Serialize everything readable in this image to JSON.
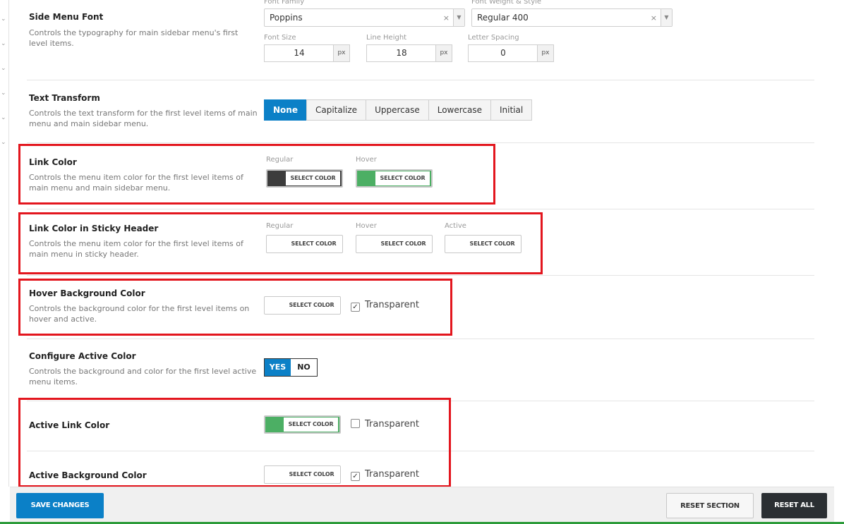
{
  "side_menu_font": {
    "title": "Side Menu Font",
    "desc": "Controls the typography for main sidebar menu's first level items.",
    "font_family_label": "Font Family",
    "font_family_value": "Poppins",
    "font_weight_label": "Font Weight & Style",
    "font_weight_value": "Regular 400",
    "font_size_label": "Font Size",
    "font_size_value": "14",
    "line_height_label": "Line Height",
    "line_height_value": "18",
    "letter_spacing_label": "Letter Spacing",
    "letter_spacing_value": "0",
    "unit": "px",
    "clear_glyph": "×",
    "arrow_glyph": "▼"
  },
  "text_transform": {
    "title": "Text Transform",
    "desc": "Controls the text transform for the first level items of main menu and main sidebar menu.",
    "options": [
      "None",
      "Capitalize",
      "Uppercase",
      "Lowercase",
      "Initial"
    ],
    "selected": "None"
  },
  "link_color": {
    "title": "Link Color",
    "desc": "Controls the menu item color for the first level items of main menu and main sidebar menu.",
    "regular_label": "Regular",
    "hover_label": "Hover",
    "regular_color": "#3c3c3c",
    "hover_color": "#4caf64"
  },
  "sticky_link_color": {
    "title": "Link Color in Sticky Header",
    "desc": "Controls the menu item color for the first level items of main menu in sticky header.",
    "regular_label": "Regular",
    "hover_label": "Hover",
    "active_label": "Active"
  },
  "hover_bg_color": {
    "title": "Hover Background Color",
    "desc": "Controls the background color for the first level items on hover and active.",
    "transparent_label": "Transparent",
    "transparent_checked": true
  },
  "configure_active": {
    "title": "Configure Active Color",
    "desc": "Controls the background and color for the first level active menu items.",
    "yes": "YES",
    "no": "NO",
    "value": "YES"
  },
  "active_link_color": {
    "title": "Active Link Color",
    "color": "#4caf64",
    "transparent_label": "Transparent",
    "transparent_checked": false
  },
  "active_bg_color": {
    "title": "Active Background Color",
    "transparent_label": "Transparent",
    "transparent_checked": true
  },
  "select_color_label": "SELECT COLOR",
  "check_glyph": "✓",
  "chevron_glyph": "⌄",
  "footer": {
    "save": "SAVE CHANGES",
    "reset_section": "RESET SECTION",
    "reset_all": "RESET ALL"
  },
  "colors": {
    "accent": "#0b80c7",
    "highlight_box": "#e3161e",
    "green": "#4caf64"
  }
}
